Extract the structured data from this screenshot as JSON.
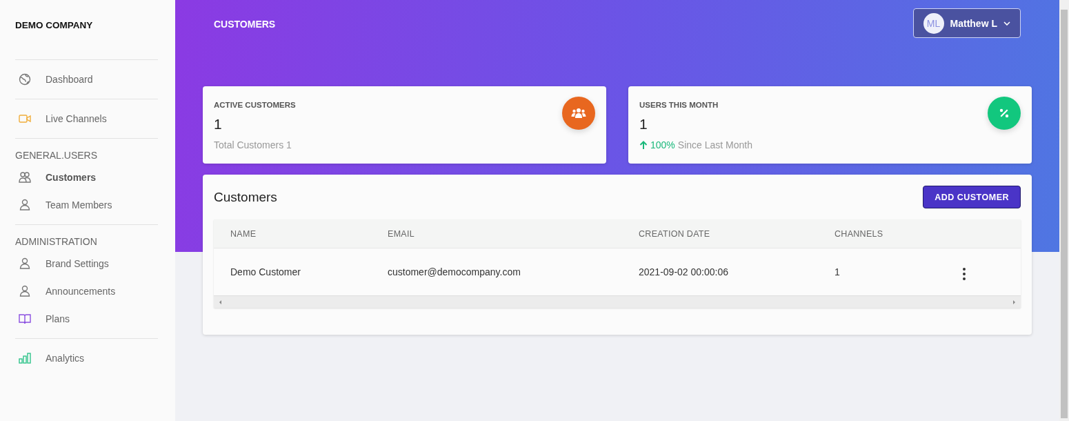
{
  "sidebar": {
    "brand": "DEMO COMPANY",
    "groups": [
      {
        "items": [
          {
            "label": "Dashboard",
            "kind": "globe",
            "selected": false
          }
        ]
      },
      {
        "items": [
          {
            "label": "Live Channels",
            "kind": "video",
            "selected": false
          }
        ]
      },
      {
        "heading": "GENERAL.USERS",
        "items": [
          {
            "label": "Customers",
            "kind": "users",
            "selected": true
          },
          {
            "label": "Team Members",
            "kind": "user",
            "selected": false
          }
        ]
      },
      {
        "heading": "ADMINISTRATION",
        "items": [
          {
            "label": "Brand Settings",
            "kind": "user",
            "selected": false
          },
          {
            "label": "Announcements",
            "kind": "user",
            "selected": false
          },
          {
            "label": "Plans",
            "kind": "book",
            "selected": false
          }
        ]
      },
      {
        "items": [
          {
            "label": "Analytics",
            "kind": "chart",
            "selected": false
          }
        ]
      }
    ]
  },
  "header": {
    "title": "CUSTOMERS",
    "user": {
      "initials": "ML",
      "name": "Matthew L"
    }
  },
  "stats": [
    {
      "title": "ACTIVE CUSTOMERS",
      "value": "1",
      "kind": "users",
      "color": "#e8671f",
      "note": "Total Customers 1"
    },
    {
      "title": "USERS THIS MONTH",
      "value": "1",
      "kind": "percent",
      "color": "#12c77e",
      "change": "100%",
      "note": "Since Last Month"
    }
  ],
  "customers": {
    "title": "Customers",
    "button": "ADD CUSTOMER",
    "columns": [
      "NAME",
      "EMAIL",
      "CREATION DATE",
      "CHANNELS"
    ],
    "rows": [
      {
        "cells": [
          "Demo Customer",
          "customer@democompany.com",
          "2021-09-02 00:00:06",
          "1"
        ]
      }
    ]
  }
}
